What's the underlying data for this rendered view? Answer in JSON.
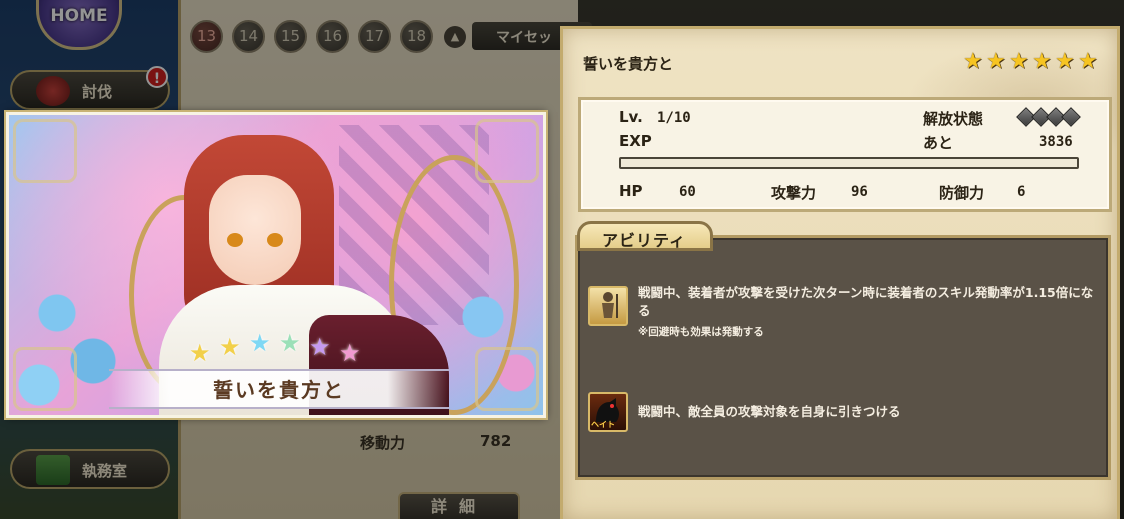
{
  "nav": {
    "home_label": "HOME",
    "subjugate_label": "討伐",
    "alert_badge": "!",
    "office_label": "執務室"
  },
  "background": {
    "page_numbers": [
      "13",
      "14",
      "15",
      "16",
      "17",
      "18"
    ],
    "myset_label": "マイセッ",
    "stats": [
      {
        "label": "移動力",
        "value": "782"
      }
    ],
    "detail_button": "詳細"
  },
  "card": {
    "title": "誓いを貴方と",
    "rarity_stars": 6
  },
  "detail": {
    "title": "誓いを貴方と",
    "stars": 6,
    "level_label": "Lv.",
    "level_value": "1/10",
    "unlock_label": "解放状態",
    "unlock_keys": 4,
    "exp_label": "EXP",
    "remaining_label": "あと",
    "remaining_value": "3836",
    "exp_progress": 0.0,
    "hp_label": "HP",
    "hp_value": "60",
    "atk_label": "攻撃力",
    "atk_value": "96",
    "def_label": "防御力",
    "def_value": "6"
  },
  "ability": {
    "tab_label": "アビリティ",
    "items": [
      {
        "icon": "knight-ability-icon",
        "text": "戦闘中、装着者が攻撃を受けた次ターン時に装着者のスキル発動率が1.15倍になる",
        "note": "※回避時も効果は発動する"
      },
      {
        "icon": "hate-ability-icon",
        "icon_label": "ヘイト",
        "text": "戦闘中、敵全員の攻撃対象を自身に引きつける"
      }
    ]
  },
  "colors": {
    "star_gold": "#f6c422",
    "panel_parchment": "#efe3c3",
    "ability_box": "#5a5247"
  }
}
